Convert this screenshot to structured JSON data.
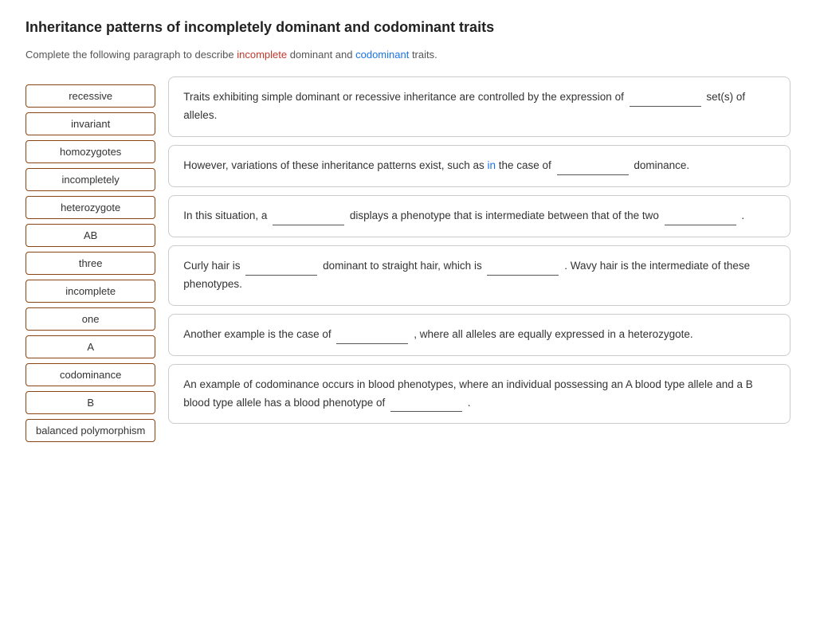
{
  "page": {
    "title": "Inheritance patterns of incompletely dominant and codominant traits",
    "subtitle": "Complete the following paragraph to describe incomplete dominant and codominant traits.",
    "subtitle_parts": [
      {
        "text": "Complete the following paragraph to describe ",
        "type": "normal"
      },
      {
        "text": "incomplete",
        "type": "red"
      },
      {
        "text": " dominant and ",
        "type": "normal"
      },
      {
        "text": "codominant",
        "type": "blue"
      },
      {
        "text": " traits.",
        "type": "normal"
      }
    ]
  },
  "word_bank": {
    "items": [
      {
        "label": "recessive"
      },
      {
        "label": "invariant"
      },
      {
        "label": "homozygotes"
      },
      {
        "label": "incompletely"
      },
      {
        "label": "heterozygote"
      },
      {
        "label": "AB"
      },
      {
        "label": "three"
      },
      {
        "label": "incomplete"
      },
      {
        "label": "one"
      },
      {
        "label": "A"
      },
      {
        "label": "codominance"
      },
      {
        "label": "B"
      },
      {
        "label": "balanced polymorphism"
      }
    ]
  },
  "sentences": [
    {
      "id": 1,
      "text_before": "Traits exhibiting simple dominant or recessive inheritance are controlled by the expression of",
      "blank": true,
      "text_after": "set(s) of alleles."
    },
    {
      "id": 2,
      "text_before": "However, variations of these inheritance patterns exist, such as",
      "highlight_in": true,
      "text_middle": " in the case of",
      "blank": true,
      "text_after": "dominance."
    },
    {
      "id": 3,
      "text_before": "In this situation, a",
      "blank1": true,
      "text_middle": "displays a phenotype that is intermediate between that of the two",
      "blank2": true,
      "text_after": "."
    },
    {
      "id": 4,
      "text_before": "Curly hair is",
      "blank1": true,
      "text_middle": "dominant to straight hair, which is",
      "blank2": true,
      "text_after": ". Wavy hair is the intermediate of these phenotypes."
    },
    {
      "id": 5,
      "text_before": "Another example is the case of",
      "blank": true,
      "text_after": ", where all alleles are equally expressed in a heterozygote."
    },
    {
      "id": 6,
      "text_before": "An example of codominance occurs in blood phenotypes, where an individual possessing an A blood type allele and a B blood type allele has a blood phenotype of",
      "blank": true,
      "text_after": "."
    }
  ]
}
